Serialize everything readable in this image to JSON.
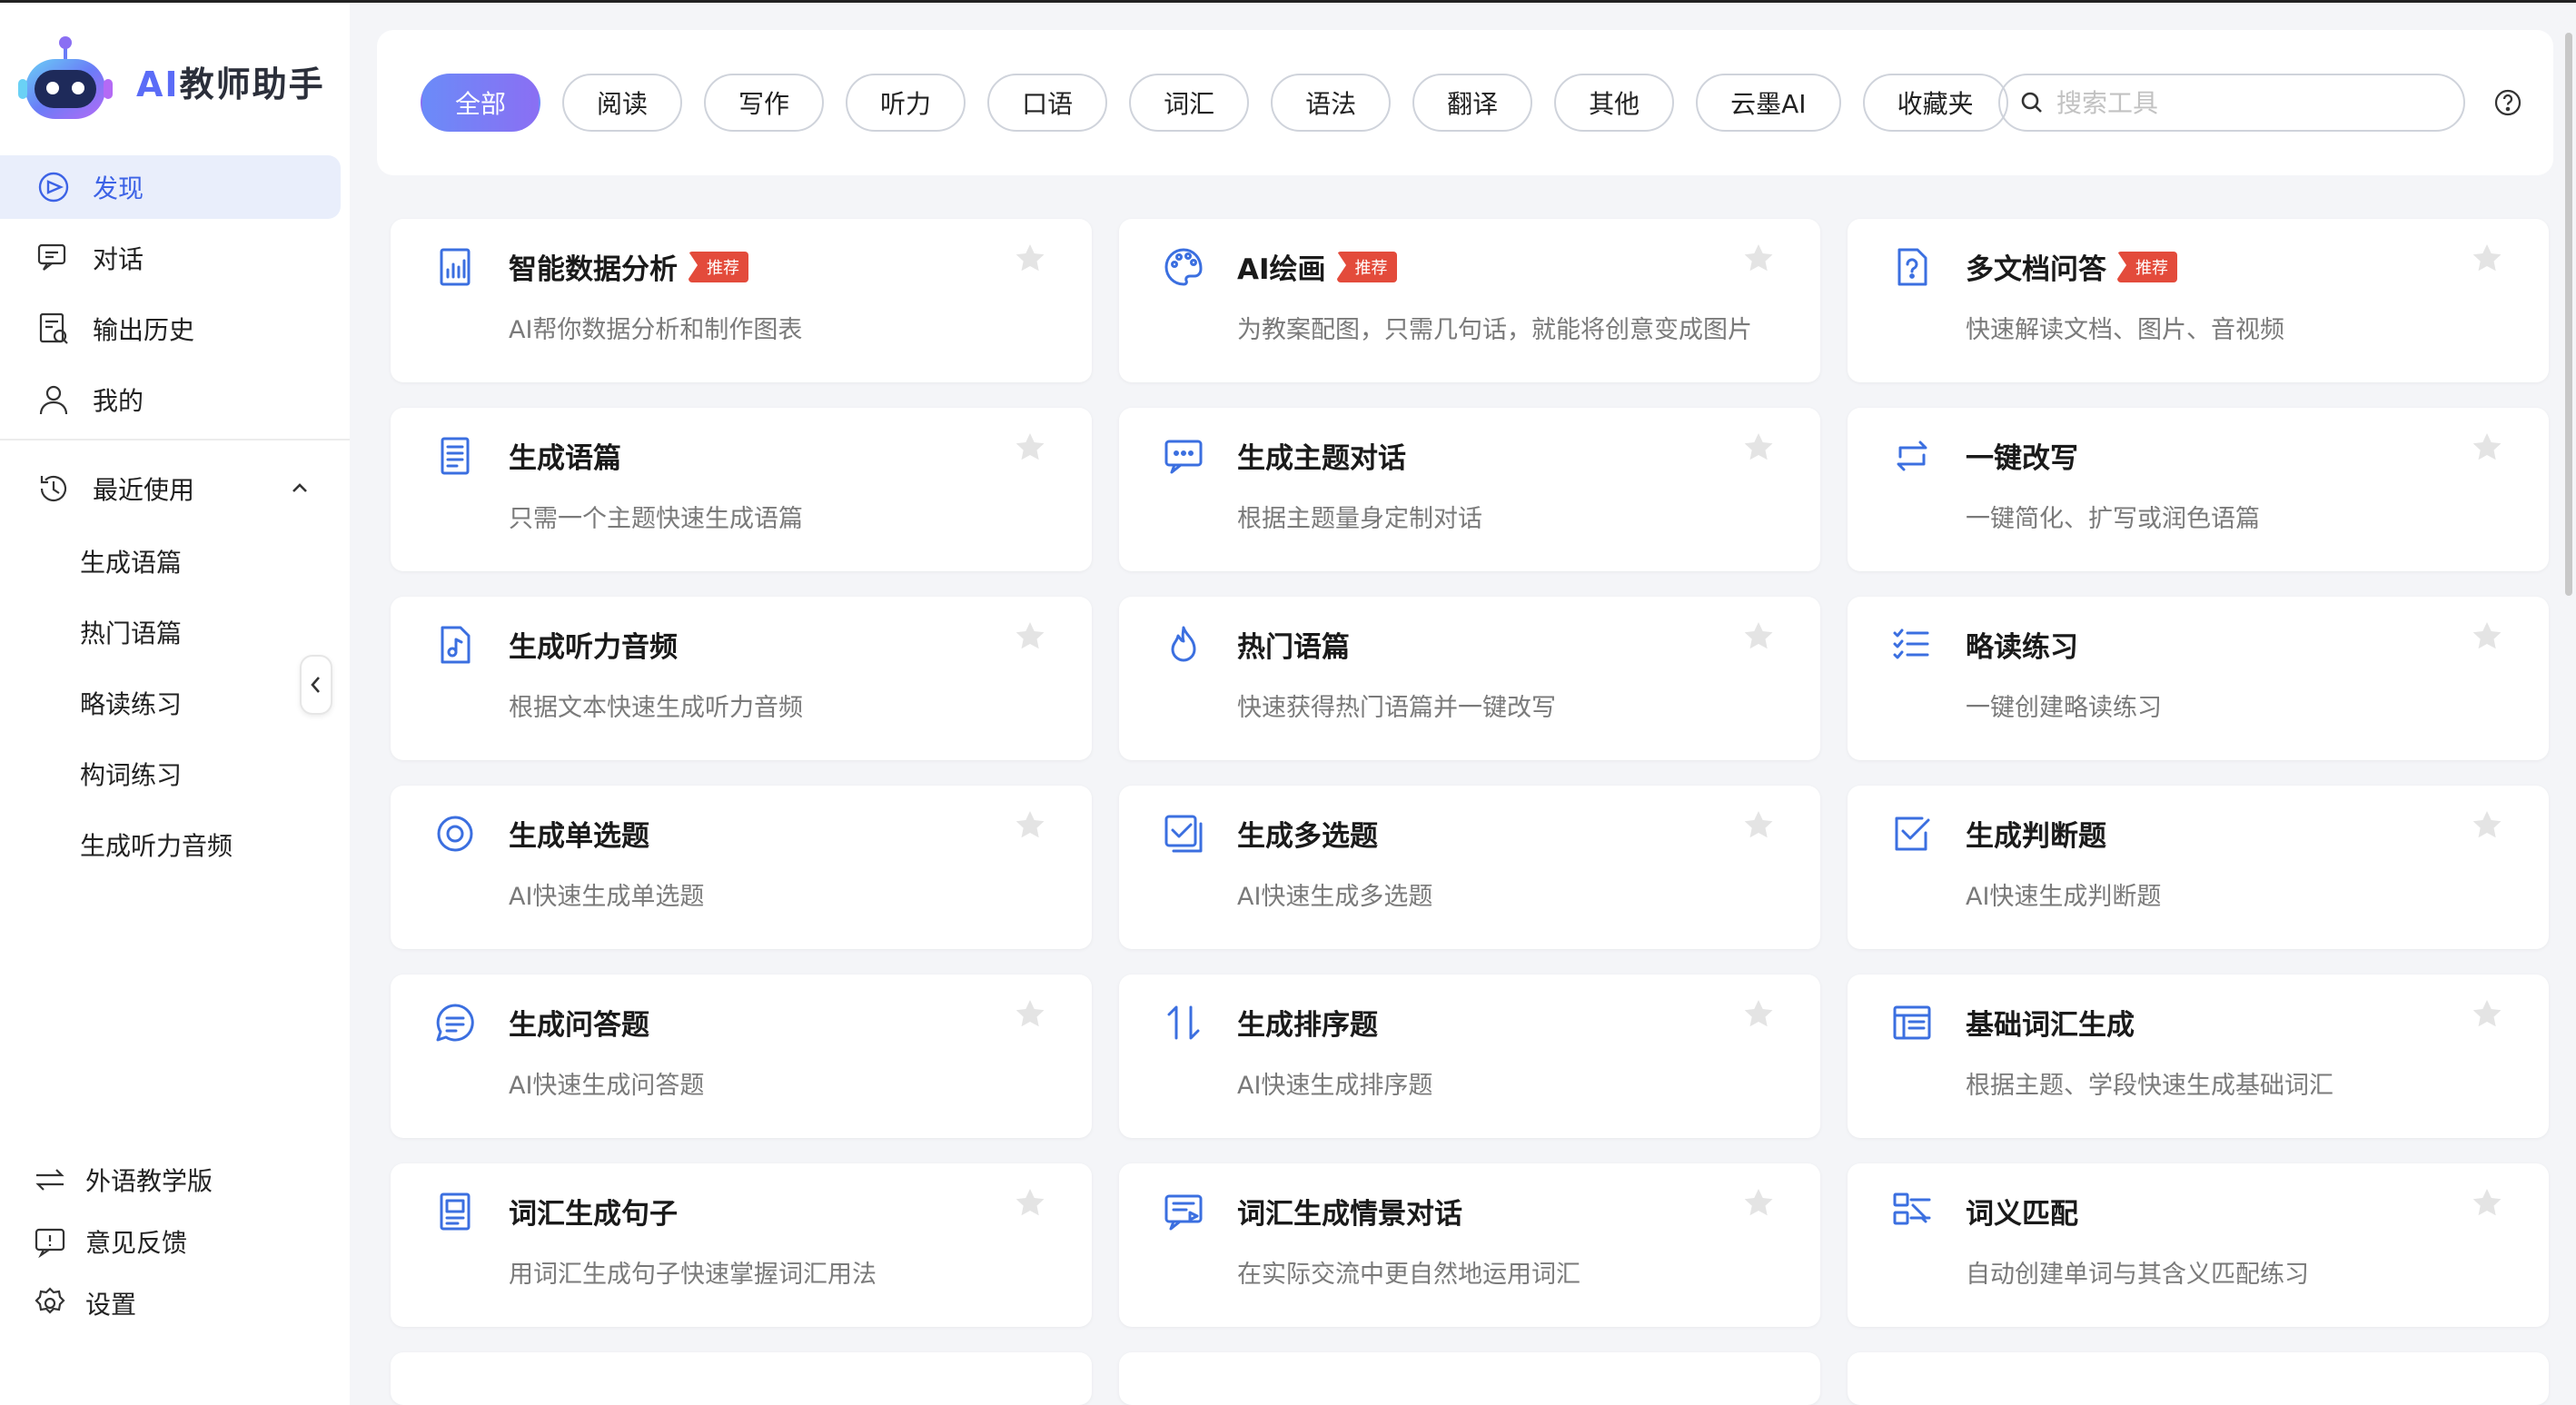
{
  "app": {
    "logo_ai": "AI",
    "logo_rest": "教师助手"
  },
  "sidebar": {
    "nav": [
      {
        "label": "发现",
        "icon": "discover-icon",
        "active": true
      },
      {
        "label": "对话",
        "icon": "chat-icon"
      },
      {
        "label": "输出历史",
        "icon": "history-doc-icon"
      },
      {
        "label": "我的",
        "icon": "user-icon"
      }
    ],
    "recent_label": "最近使用",
    "recent": [
      "生成语篇",
      "热门语篇",
      "略读练习",
      "构词练习",
      "生成听力音频"
    ],
    "bottom": [
      {
        "label": "外语教学版",
        "icon": "switch-icon"
      },
      {
        "label": "意见反馈",
        "icon": "feedback-icon"
      },
      {
        "label": "设置",
        "icon": "settings-icon"
      }
    ]
  },
  "filters": [
    "全部",
    "阅读",
    "写作",
    "听力",
    "口语",
    "词汇",
    "语法",
    "翻译",
    "其他",
    "云墨AI",
    "收藏夹"
  ],
  "search": {
    "placeholder": "搜索工具"
  },
  "badge_label": "推荐",
  "cards": [
    {
      "title": "智能数据分析",
      "desc": "AI帮你数据分析和制作图表",
      "badge": true,
      "icon": "chart-doc-icon"
    },
    {
      "title": "AI绘画",
      "desc": "为教案配图，只需几句话，就能将创意变成图片",
      "badge": true,
      "icon": "palette-icon"
    },
    {
      "title": "多文档问答",
      "desc": "快速解读文档、图片、音视频",
      "badge": true,
      "icon": "doc-question-icon"
    },
    {
      "title": "生成语篇",
      "desc": "只需一个主题快速生成语篇",
      "icon": "document-icon"
    },
    {
      "title": "生成主题对话",
      "desc": "根据主题量身定制对话",
      "icon": "message-icon"
    },
    {
      "title": "一键改写",
      "desc": "一键简化、扩写或润色语篇",
      "icon": "rewrite-arrows-icon"
    },
    {
      "title": "生成听力音频",
      "desc": "根据文本快速生成听力音频",
      "icon": "audio-file-icon"
    },
    {
      "title": "热门语篇",
      "desc": "快速获得热门语篇并一键改写",
      "icon": "flame-icon"
    },
    {
      "title": "略读练习",
      "desc": "一键创建略读练习",
      "icon": "checklist-icon"
    },
    {
      "title": "生成单选题",
      "desc": "AI快速生成单选题",
      "icon": "radio-icon"
    },
    {
      "title": "生成多选题",
      "desc": "AI快速生成多选题",
      "icon": "multi-check-icon"
    },
    {
      "title": "生成判断题",
      "desc": "AI快速生成判断题",
      "icon": "check-square-icon"
    },
    {
      "title": "生成问答题",
      "desc": "AI快速生成问答题",
      "icon": "qa-bubble-icon"
    },
    {
      "title": "生成排序题",
      "desc": "AI快速生成排序题",
      "icon": "sort-arrows-icon"
    },
    {
      "title": "基础词汇生成",
      "desc": "根据主题、学段快速生成基础词汇",
      "icon": "vocab-table-icon"
    },
    {
      "title": "词汇生成句子",
      "desc": "用词汇生成句子快速掌握词汇用法",
      "icon": "sentence-doc-icon"
    },
    {
      "title": "词汇生成情景对话",
      "desc": "在实际交流中更自然地运用词汇",
      "icon": "scene-chat-icon"
    },
    {
      "title": "词义匹配",
      "desc": "自动创建单词与其含义匹配练习",
      "icon": "match-icon"
    }
  ],
  "colors": {
    "accent": "#3d63e6",
    "badge": "#e34b3b",
    "icon_blue": "#3b6fe0"
  }
}
